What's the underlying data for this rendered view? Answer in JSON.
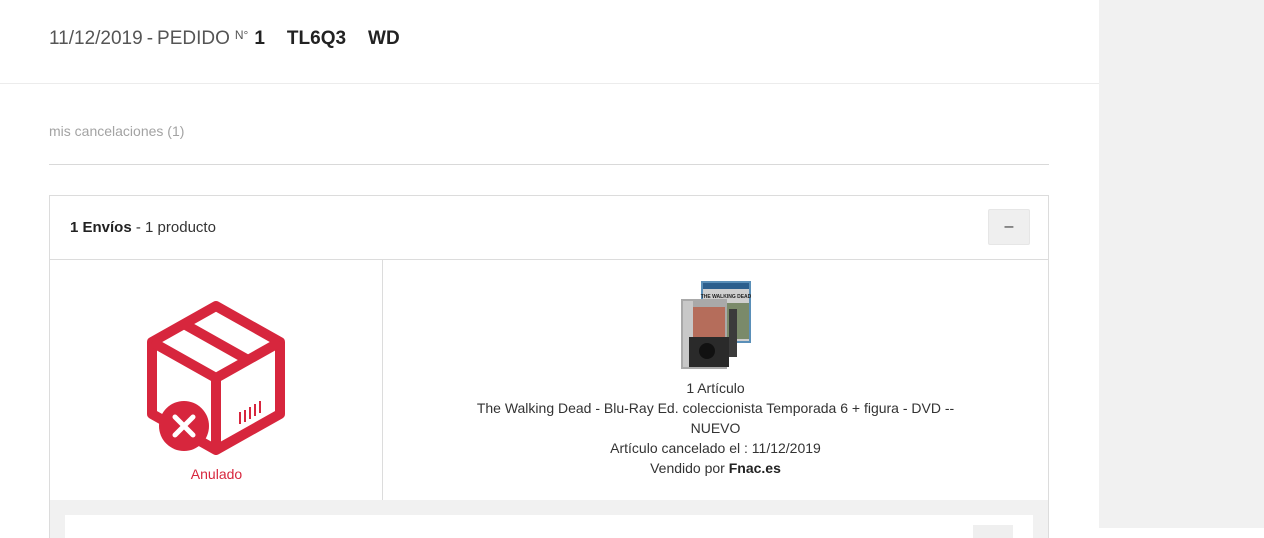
{
  "order": {
    "date": "11/12/2019",
    "separator": "-",
    "label": "PEDIDO",
    "number_symbol": "N°",
    "number": "1",
    "code": "TL6Q3",
    "code_suffix": "WD"
  },
  "cancellations": {
    "title": "mis cancelaciones (1)"
  },
  "shipment": {
    "count_label": "1 Envíos",
    "separator": " - ",
    "products_label": "1 producto",
    "collapse_label": "–",
    "status": "Anulado",
    "status_color": "#d7263d",
    "status_icon": "cancelled-box-icon"
  },
  "product": {
    "quantity": "1 Artículo",
    "name": "The Walking Dead - Blu-Ray Ed. coleccionista Temporada 6 + figura - DVD -- NUEVO",
    "cancelled_prefix": "Artículo cancelado el : ",
    "cancelled_date": "11/12/2019",
    "sold_by_prefix": "Vendido por ",
    "seller": "Fnac.es",
    "image_text": "THE WALKING DEAD"
  }
}
